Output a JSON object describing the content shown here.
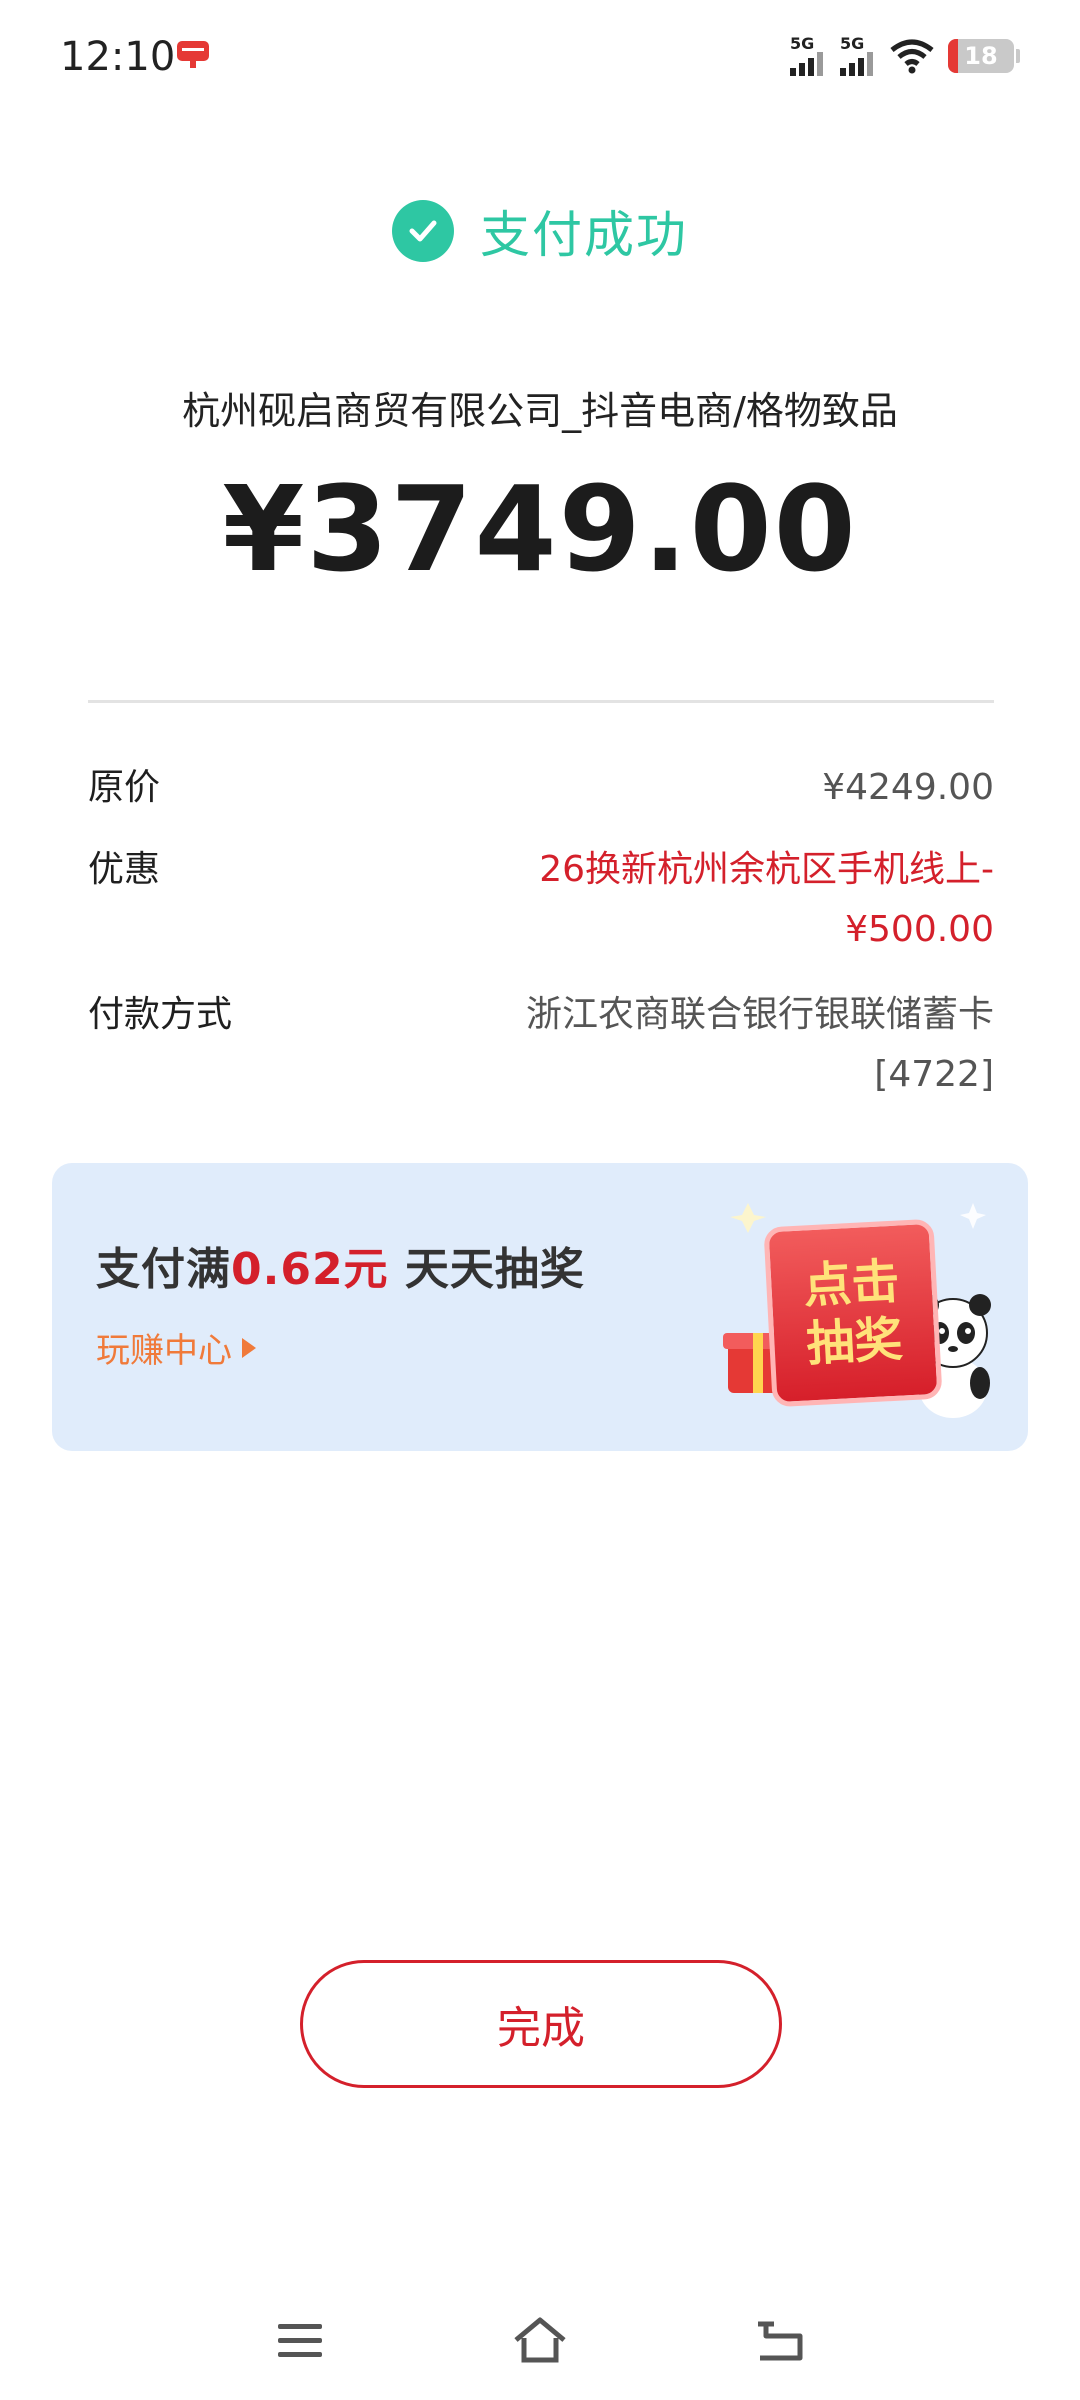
{
  "status_bar": {
    "time": "12:10",
    "signal1_label": "5G",
    "signal2_label": "5G",
    "battery_level": "18"
  },
  "header": {
    "status_text": "支付成功"
  },
  "payment": {
    "merchant": "杭州砚启商贸有限公司_抖音电商/格物致品",
    "amount": "¥3749.00"
  },
  "details": {
    "original_price_label": "原价",
    "original_price_value": "¥4249.00",
    "discount_label": "优惠",
    "discount_value_line1": "26换新杭州余杭区手机线上-",
    "discount_value_line2": "¥500.00",
    "method_label": "付款方式",
    "method_value_line1": "浙江农商联合银行银联储蓄卡",
    "method_value_line2": "[4722]"
  },
  "promo": {
    "title_prefix": "支付满",
    "title_amount": "0.62元",
    "title_suffix": " 天天抽奖",
    "link_text": "玩赚中心",
    "button_line1": "点击",
    "button_line2": "抽奖"
  },
  "actions": {
    "done_label": "完成"
  },
  "colors": {
    "success": "#2ec7a3",
    "accent_red": "#d4202b",
    "promo_bg": "#e0ecfb",
    "link_orange": "#f07a3a"
  }
}
